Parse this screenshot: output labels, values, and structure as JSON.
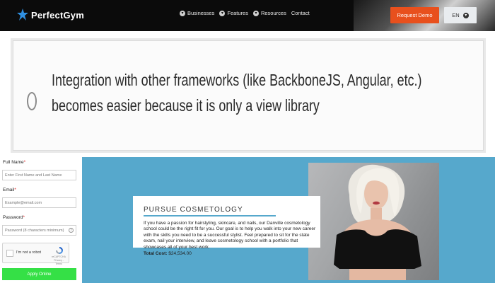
{
  "header": {
    "logo_text": "PerfectGym",
    "nav": [
      {
        "label": "Businesses",
        "icon": "chevron-down-icon"
      },
      {
        "label": "Features",
        "icon": "chevron-down-icon"
      },
      {
        "label": "Resources",
        "icon": "chevron-down-icon"
      },
      {
        "label": "Contact"
      }
    ],
    "demo_button": "Request Demo",
    "language": "EN",
    "accent_color": "#e8501d"
  },
  "quiz": {
    "option_text": "Integration with other frameworks (like BackboneJS, Angular, etc.) becomes easier because it is only a view library",
    "selected": false
  },
  "form": {
    "fields": [
      {
        "label": "Full Name",
        "required": "*",
        "placeholder": "Enter First Name and Last Name"
      },
      {
        "label": "Email",
        "required": "*",
        "placeholder": "Example@email.com"
      },
      {
        "label": "Password",
        "required": "*",
        "placeholder": "Password (8 characters minimum)"
      }
    ],
    "captcha_label": "I'm not a robot",
    "captcha_small": "reCAPTCHA Privacy - Terms",
    "submit_label": "Apply Online",
    "submit_color": "#35e046"
  },
  "promo": {
    "title": "PURSUE COSMETOLOGY",
    "body": "If you have a passion for hairstyling, skincare, and nails, our Danville cosmetology school could be the right fit for you. Our goal is to help you walk into your new career with the skills you need to be a successful stylist. Feel prepared to sit for the state exam, nail your interview, and leave cosmetology school with a portfolio that showcases all of your best work.",
    "cost_label": "Total Cost:",
    "cost_value": "$24,534.00",
    "background_color": "#56a8cc"
  }
}
